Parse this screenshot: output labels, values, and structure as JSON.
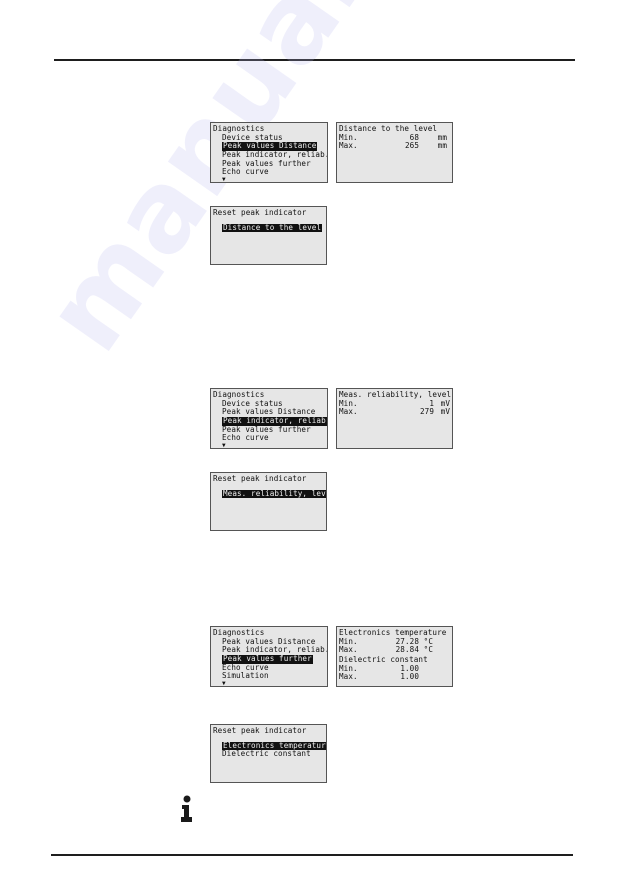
{
  "watermark": "manualshive.com",
  "sections": [
    {
      "menu": {
        "title": "Diagnostics",
        "items": [
          "Device status",
          "Peak values Distance",
          "Peak indicator, reliab.",
          "Peak values further",
          "Echo curve"
        ],
        "selected_index": 1,
        "more_indicator": "▼"
      },
      "values": {
        "title": "Distance to the level",
        "rows": [
          {
            "label": "Min.",
            "value": "68",
            "unit": "mm"
          },
          {
            "label": "Max.",
            "value": "265",
            "unit": "mm"
          }
        ]
      },
      "reset": {
        "title": "Reset peak indicator",
        "items": [
          "Distance to the level"
        ],
        "selected_index": 0
      }
    },
    {
      "menu": {
        "title": "Diagnostics",
        "items": [
          "Device status",
          "Peak values Distance",
          "Peak indicator, reliab.",
          "Peak values further",
          "Echo curve"
        ],
        "selected_index": 2,
        "more_indicator": "▼"
      },
      "values": {
        "title": "Meas. reliability, level",
        "rows": [
          {
            "label": "Min.",
            "value": "1",
            "unit": "mV"
          },
          {
            "label": "Max.",
            "value": "279",
            "unit": "mV"
          }
        ]
      },
      "reset": {
        "title": "Reset peak indicator",
        "items": [
          "Meas. reliability, level"
        ],
        "selected_index": 0
      }
    },
    {
      "menu": {
        "title": "Diagnostics",
        "items": [
          "Peak values Distance",
          "Peak indicator, reliab.",
          "Peak values further",
          "Echo curve",
          "Simulation"
        ],
        "selected_index": 2,
        "more_indicator": "▼"
      },
      "values": {
        "title": "Electronics temperature",
        "rows": [
          {
            "label": "Min.",
            "value": "27.28",
            "unit": "°C"
          },
          {
            "label": "Max.",
            "value": "28.84",
            "unit": "°C"
          }
        ],
        "subtitle": "Dielectric constant",
        "rows2": [
          {
            "label": "Min.",
            "value": "1.00",
            "unit": ""
          },
          {
            "label": "Max.",
            "value": "1.00",
            "unit": ""
          }
        ]
      },
      "reset": {
        "title": "Reset peak indicator",
        "items": [
          "Electronics temperature",
          "Dielectric constant"
        ],
        "selected_index": 0
      }
    }
  ],
  "note_icon": "info-icon"
}
